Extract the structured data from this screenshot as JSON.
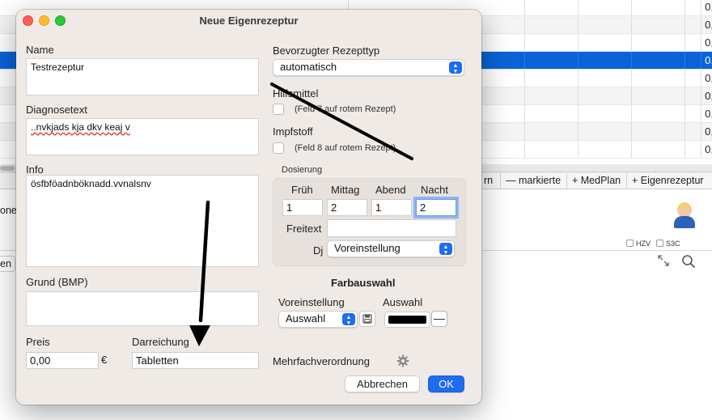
{
  "background": {
    "cell_value": "0,",
    "toolbar_buttons": [
      "rn",
      "— markierte",
      "+ MedPlan",
      "+ Eigenrezeptur"
    ],
    "partial_label_one": "one",
    "partial_label_two": "en",
    "checkbox_hzv": "HZV",
    "checkbox_s3c": "S3C",
    "selection_color": "#0a63d8"
  },
  "dialog": {
    "title": "Neue Eigenrezeptur",
    "name_label": "Name",
    "name_value": "Testrezeptur",
    "diagnose_label": "Diagnosetext",
    "diagnose_value": "..nvkjads kja dkv  keaj v",
    "info_label": "Info",
    "info_value": "ösfbföadnböknadd.vvnalsnv",
    "grund_label": "Grund (BMP)",
    "grund_value": "",
    "preis_label": "Preis",
    "preis_value": "0,00",
    "currency": "€",
    "darreichung_label": "Darreichung",
    "darreichung_value": "Tabletten",
    "rezepttyp_label": "Bevorzugter Rezepttyp",
    "rezepttyp_value": "automatisch",
    "hilfsmittel_label": "Hilfsmittel",
    "hilfsmittel_note": "(Feld 7 auf rotem Rezept)",
    "impfstoff_label": "Impfstoff",
    "impfstoff_note": "(Feld 8 auf rotem Rezept)",
    "dosierung": {
      "label": "Dosierung",
      "headers": [
        "Früh",
        "Mittag",
        "Abend",
        "Nacht"
      ],
      "values": [
        "1",
        "2",
        "1",
        "2"
      ],
      "freitext_label": "Freitext",
      "freitext_value": "",
      "dj_label": "Dj",
      "dj_value": "Voreinstellung"
    },
    "farbauswahl": {
      "heading": "Farbauswahl",
      "preset_label": "Voreinstellung",
      "preset_value": "Auswahl",
      "selection_label": "Auswahl",
      "selected_color": "#000000",
      "minus_label": "—"
    },
    "mehrfach_label": "Mehrfachverordnung",
    "cancel_label": "Abbrechen",
    "ok_label": "OK",
    "accent_color": "#1e6cf0"
  }
}
